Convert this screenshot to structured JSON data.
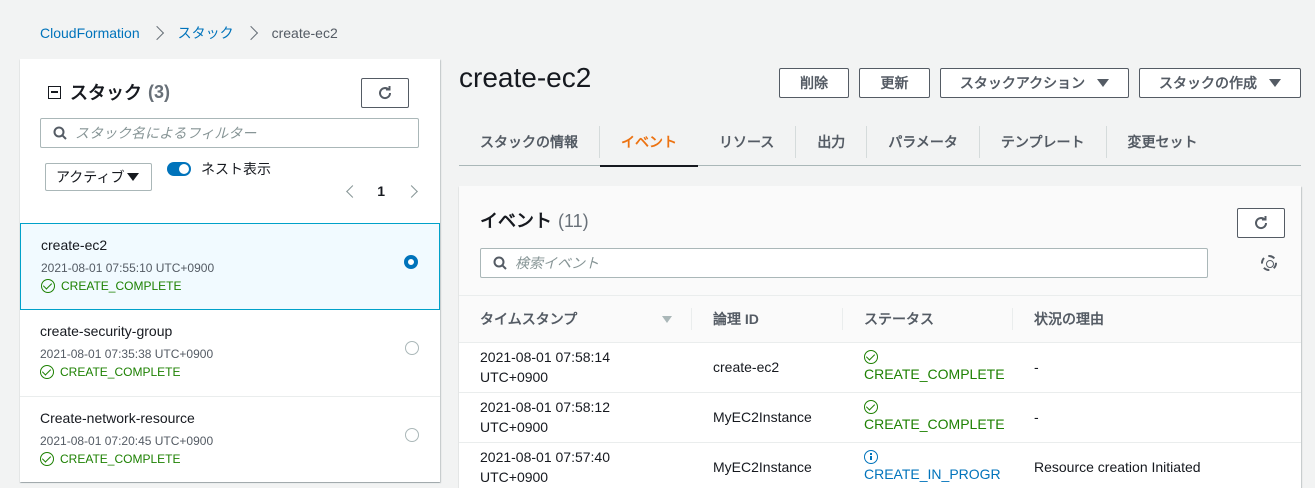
{
  "breadcrumb": {
    "root": "CloudFormation",
    "stacks": "スタック",
    "current": "create-ec2"
  },
  "left_panel": {
    "title": "スタック",
    "count": "(3)",
    "search_placeholder": "スタック名によるフィルター",
    "filter_select": "アクティブ",
    "toggle_label": "ネスト表示",
    "page": "1",
    "stacks": [
      {
        "name": "create-ec2",
        "time": "2021-08-01 07:55:10 UTC+0900",
        "status": "CREATE_COMPLETE",
        "selected": true
      },
      {
        "name": "create-security-group",
        "time": "2021-08-01 07:35:38 UTC+0900",
        "status": "CREATE_COMPLETE",
        "selected": false
      },
      {
        "name": "Create-network-resource",
        "time": "2021-08-01 07:20:45 UTC+0900",
        "status": "CREATE_COMPLETE",
        "selected": false
      }
    ]
  },
  "stack_title": "create-ec2",
  "buttons": {
    "delete": "削除",
    "update": "更新",
    "stack_action": "スタックアクション",
    "create_stack": "スタックの作成"
  },
  "tabs": [
    "スタックの情報",
    "イベント",
    "リソース",
    "出力",
    "パラメータ",
    "テンプレート",
    "変更セット"
  ],
  "events": {
    "title": "イベント",
    "count": "(11)",
    "search_placeholder": "検索イベント",
    "columns": [
      "タイムスタンプ",
      "論理 ID",
      "ステータス",
      "状況の理由"
    ],
    "rows": [
      {
        "date": "2021-08-01 07:58:14",
        "tz": "UTC+0900",
        "logical_id": "create-ec2",
        "status": "CREATE_COMPLETE",
        "reason": "-"
      },
      {
        "date": "2021-08-01 07:58:12",
        "tz": "UTC+0900",
        "logical_id": "MyEC2Instance",
        "status": "CREATE_COMPLETE",
        "reason": "-"
      },
      {
        "date": "2021-08-01 07:57:40",
        "tz": "UTC+0900",
        "logical_id": "MyEC2Instance",
        "status": "CREATE_IN_PROGR",
        "reason": "Resource creation Initiated"
      }
    ]
  },
  "colors": {
    "link": "#0073bb",
    "success": "#1d8102",
    "tab_active": "#ec7211"
  }
}
